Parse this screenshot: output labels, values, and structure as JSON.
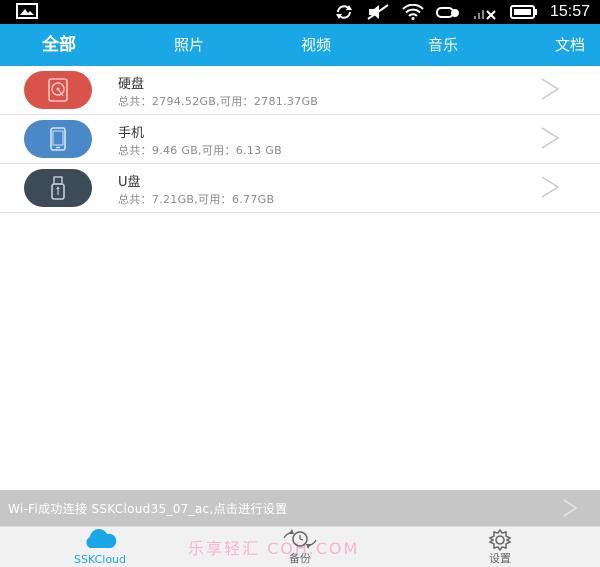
{
  "status_bar": {
    "time": "15:57"
  },
  "tabs": [
    {
      "label": "全部",
      "active": true
    },
    {
      "label": "照片",
      "active": false
    },
    {
      "label": "视频",
      "active": false
    },
    {
      "label": "音乐",
      "active": false
    },
    {
      "label": "文档",
      "active": false
    }
  ],
  "storage": [
    {
      "name": "硬盘",
      "detail": "总共：2794.52GB,可用：2781.37GB",
      "icon": "hard-disk-icon",
      "color": "#d9534a"
    },
    {
      "name": "手机",
      "detail": "总共：9.46 GB,可用：6.13 GB",
      "icon": "phone-icon",
      "color": "#4a88c8"
    },
    {
      "name": "U盘",
      "detail": "总共：7.21GB,可用：6.77GB",
      "icon": "usb-drive-icon",
      "color": "#3d4a57"
    }
  ],
  "notice": {
    "text": "Wi-Fi成功连接 SSKCloud35_07_ac,点击进行设置"
  },
  "bottom_nav": [
    {
      "label": "SSKCloud",
      "icon": "cloud-icon",
      "active": true
    },
    {
      "label": "备份",
      "icon": "backup-clock-icon",
      "active": false
    },
    {
      "label": "设置",
      "icon": "settings-gear-icon",
      "active": false
    }
  ],
  "watermark": "乐享轻汇 COH.COM",
  "colors": {
    "accent": "#1aa7e6",
    "notice_bg": "#c6c6c6"
  }
}
